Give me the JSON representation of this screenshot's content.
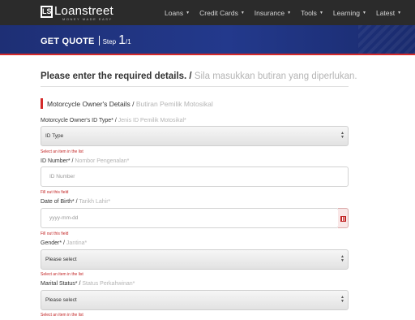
{
  "brand": {
    "name": "Loanstreet",
    "logo_mark": "LS",
    "tagline": "MONEY MADE EASY"
  },
  "nav": [
    {
      "label": "Loans"
    },
    {
      "label": "Credit Cards"
    },
    {
      "label": "Insurance"
    },
    {
      "label": "Tools"
    },
    {
      "label": "Learning"
    },
    {
      "label": "Latest"
    }
  ],
  "banner": {
    "title": "GET QUOTE",
    "step_label": "Step",
    "step_current": "1",
    "step_total": "/1"
  },
  "form": {
    "heading": "Please enter the required details. /",
    "heading_malay": "Sila masukkan butiran yang diperlukan.",
    "section_title": "Motorcycle Owner's Details /",
    "section_title_malay": "Butiran Pemilik Motosikal",
    "id_type": {
      "label": "Motorcycle Owner's ID Type* /",
      "label_malay": "Jenis ID Pemilik Motosikal*",
      "value": "ID Type",
      "error": "Select an item in the list"
    },
    "id_number": {
      "label": "ID Number* /",
      "label_malay": "Nombor Pengenalan*",
      "placeholder": "ID Number",
      "error": "Fill out this field"
    },
    "dob": {
      "label": "Date of Birth* /",
      "label_malay": "Tarikh Lahir*",
      "placeholder": "yyyy-mm-dd",
      "error": "Fill out this field"
    },
    "gender": {
      "label": "Gender* /",
      "label_malay": "Jantina*",
      "value": "Please select",
      "error": "Select an item in the list"
    },
    "marital": {
      "label": "Marital Status* /",
      "label_malay": "Status Perkahwinan*",
      "value": "Please select",
      "error": "Select an item in the list"
    }
  },
  "colors": {
    "accent_red": "#d42a2a",
    "banner_blue": "#23398c",
    "nav_bg": "#2b2b2b"
  }
}
